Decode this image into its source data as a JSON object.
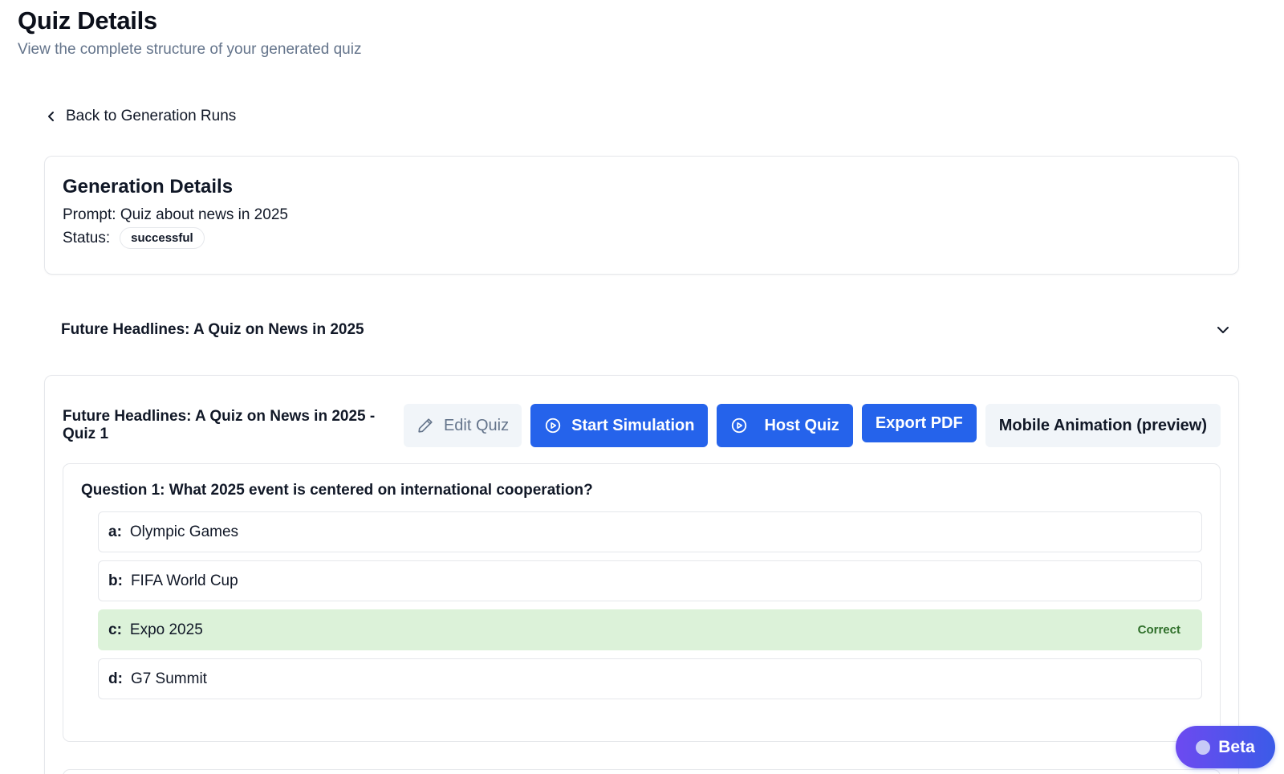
{
  "header": {
    "title": "Quiz Details",
    "subtitle": "View the complete structure of your generated quiz"
  },
  "back_link": {
    "label": "Back to Generation Runs"
  },
  "generation": {
    "title": "Generation Details",
    "prompt_label": "Prompt:",
    "prompt_value": "Quiz about news in 2025",
    "status_label": "Status:",
    "status_value": "successful"
  },
  "collection": {
    "title": "Future Headlines: A Quiz on News in 2025",
    "icon": "chevron-down-icon"
  },
  "quiz": {
    "title": "Future Headlines: A Quiz on News in 2025 - Quiz 1",
    "buttons": {
      "edit": "Edit Quiz",
      "simulate": "Start Simulation",
      "host": "Host Quiz",
      "export": "Export PDF",
      "mobile": "Mobile Animation (preview)"
    },
    "question": {
      "text": "Question 1: What 2025 event is centered on international cooperation?",
      "options": [
        {
          "letter": "a:",
          "text": "Olympic Games"
        },
        {
          "letter": "b:",
          "text": "FIFA World Cup"
        },
        {
          "letter": "c:",
          "text": "Expo 2025",
          "tag": "Correct"
        },
        {
          "letter": "d:",
          "text": "G7 Summit"
        }
      ]
    }
  },
  "beta": {
    "label": "Beta"
  },
  "colors": {
    "primary": "#2563eb",
    "correct_bg": "#dcf2d9",
    "correct_text": "#2f6f2a",
    "muted": "#64748b"
  }
}
